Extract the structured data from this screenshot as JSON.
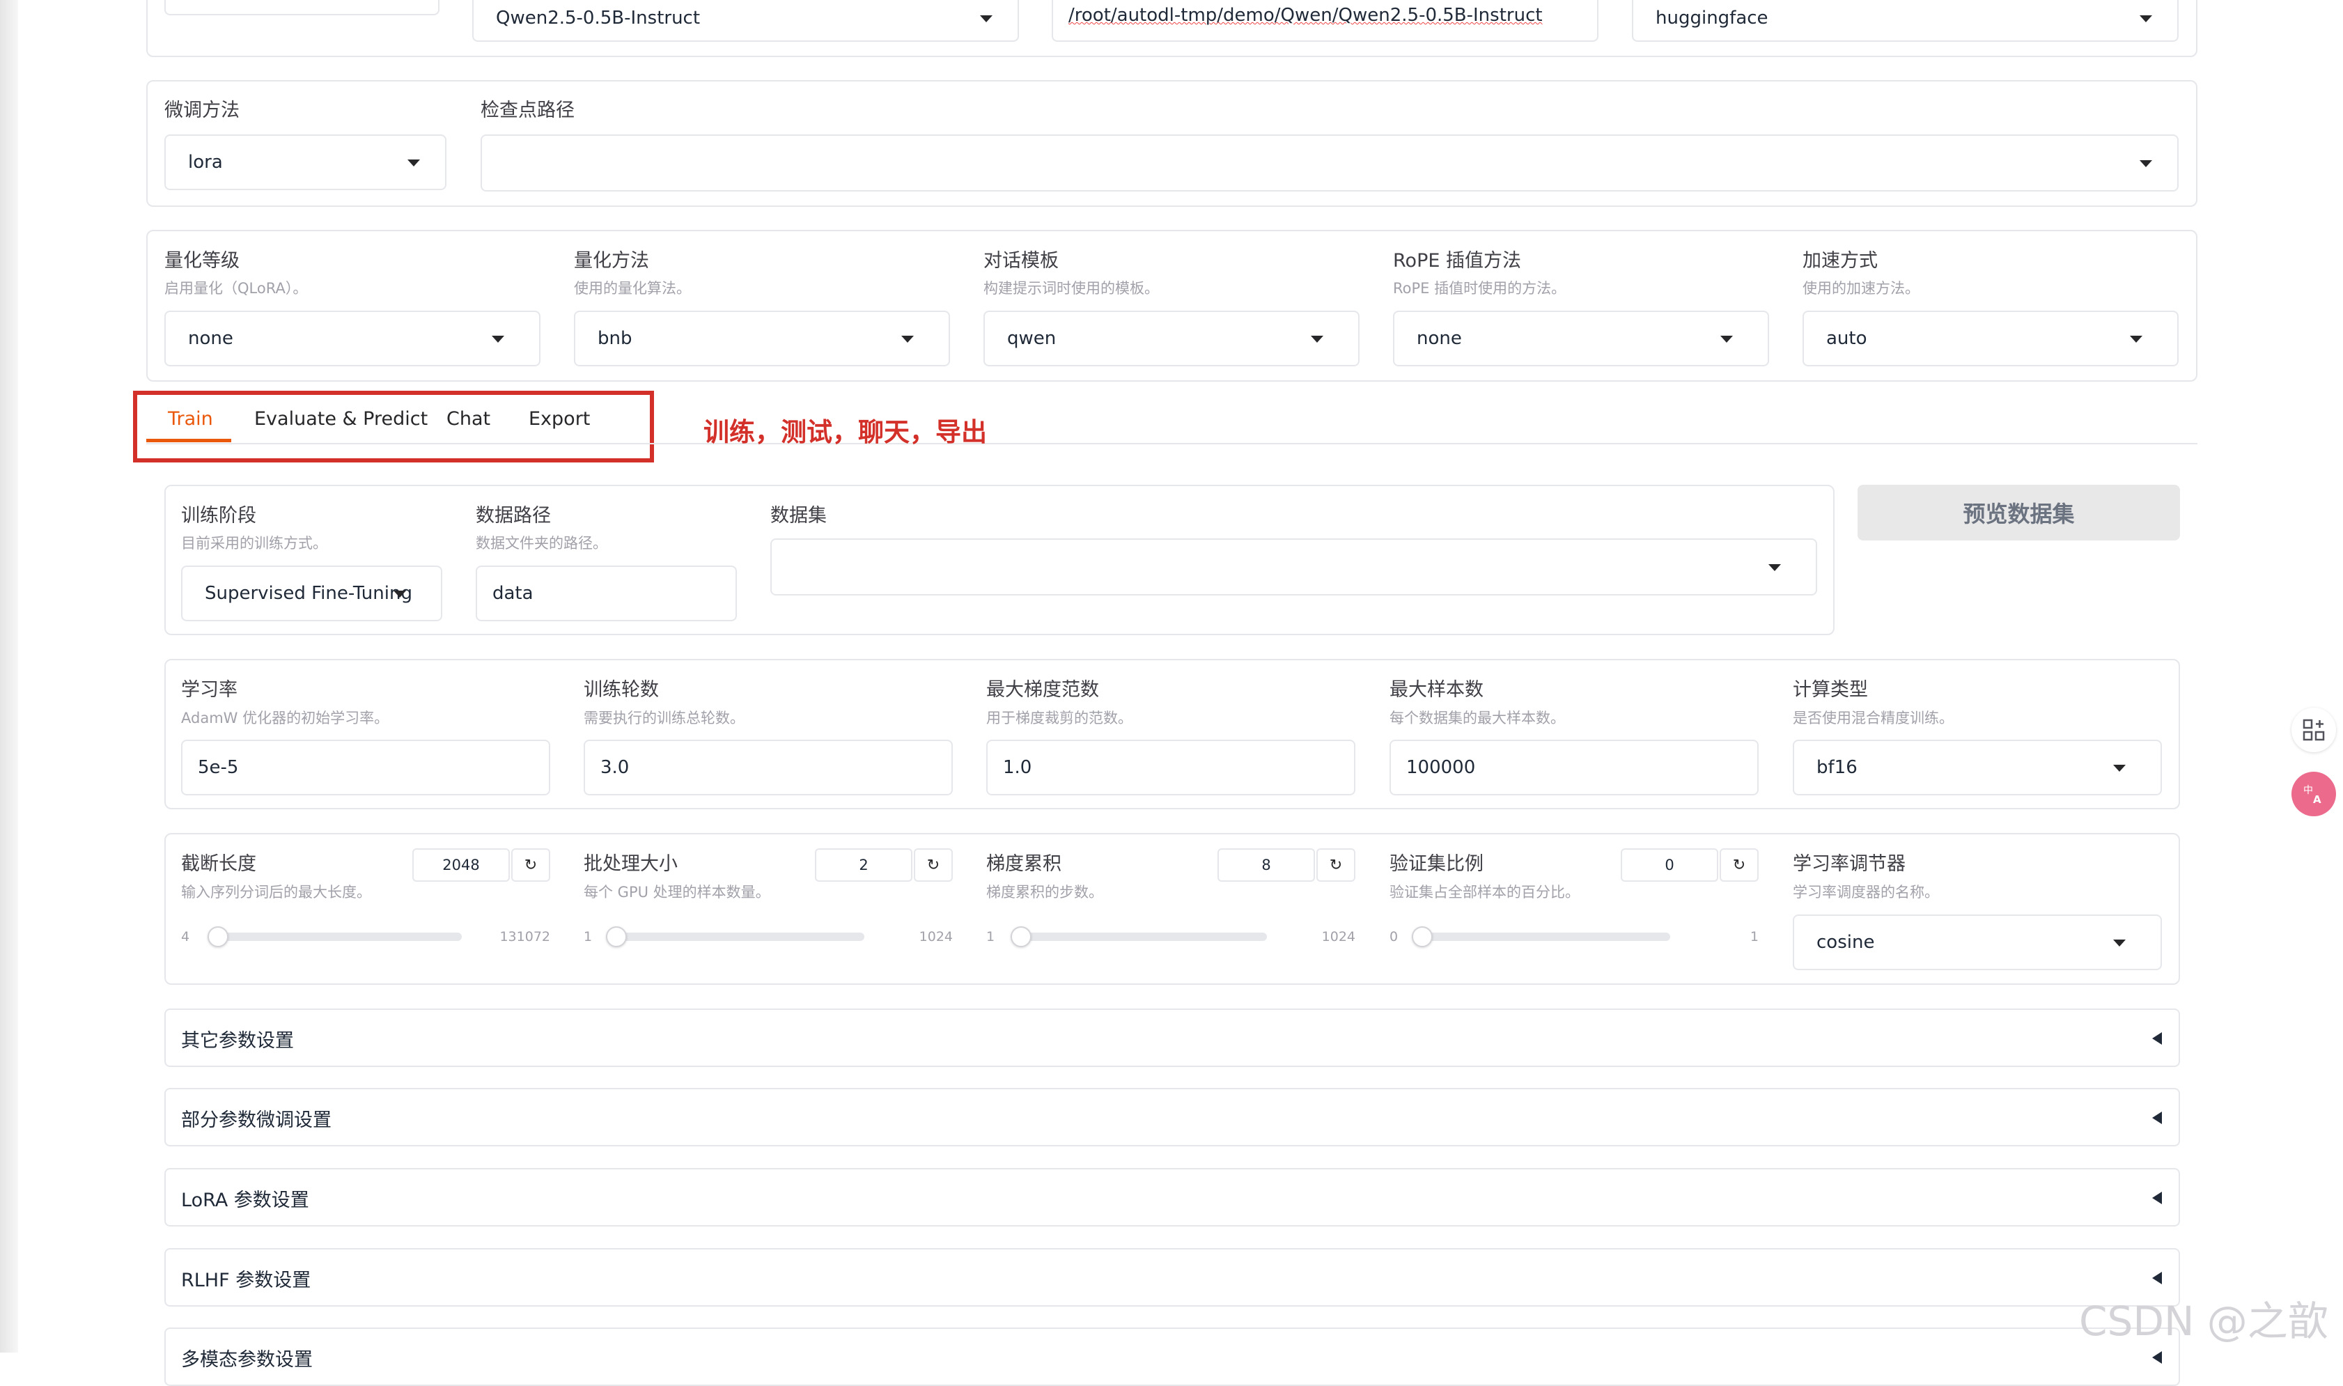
{
  "top_row": {
    "model_name": "Qwen2.5-0.5B-Instruct",
    "model_path": "/root/autodl-tmp/demo/Qwen/Qwen2.5-0.5B-Instruct",
    "hub": "huggingface"
  },
  "finetune": {
    "method_label": "微调方法",
    "method_value": "lora",
    "checkpoint_label": "检查点路径",
    "checkpoint_value": ""
  },
  "quant_row": [
    {
      "label": "量化等级",
      "info": "启用量化（QLoRA）。",
      "value": "none"
    },
    {
      "label": "量化方法",
      "info": "使用的量化算法。",
      "value": "bnb"
    },
    {
      "label": "对话模板",
      "info": "构建提示词时使用的模板。",
      "value": "qwen"
    },
    {
      "label": "RoPE 插值方法",
      "info": "RoPE 插值时使用的方法。",
      "value": "none"
    },
    {
      "label": "加速方式",
      "info": "使用的加速方法。",
      "value": "auto"
    }
  ],
  "tabs": [
    {
      "label": "Train",
      "active": true
    },
    {
      "label": "Evaluate & Predict",
      "active": false
    },
    {
      "label": "Chat",
      "active": false
    },
    {
      "label": "Export",
      "active": false
    }
  ],
  "annotation": {
    "text": "训练，测试，聊天，导出",
    "color": "#d3302a"
  },
  "train_stage": {
    "stage_label": "训练阶段",
    "stage_info": "目前采用的训练方式。",
    "stage_value": "Supervised Fine-Tuning",
    "dir_label": "数据路径",
    "dir_info": "数据文件夹的路径。",
    "dir_value": "data",
    "dataset_label": "数据集",
    "dataset_value": "",
    "preview_button": "预览数据集"
  },
  "hyper_row": [
    {
      "label": "学习率",
      "info": "AdamW 优化器的初始学习率。",
      "value": "5e-5"
    },
    {
      "label": "训练轮数",
      "info": "需要执行的训练总轮数。",
      "value": "3.0"
    },
    {
      "label": "最大梯度范数",
      "info": "用于梯度裁剪的范数。",
      "value": "1.0"
    },
    {
      "label": "最大样本数",
      "info": "每个数据集的最大样本数。",
      "value": "100000"
    },
    {
      "label": "计算类型",
      "info": "是否使用混合精度训练。",
      "value": "bf16"
    }
  ],
  "slider_row": [
    {
      "label": "截断长度",
      "info": "输入序列分词后的最大长度。",
      "value": "2048",
      "min": "4",
      "max": "131072",
      "fraction": 0.016
    },
    {
      "label": "批处理大小",
      "info": "每个 GPU 处理的样本数量。",
      "value": "2",
      "min": "1",
      "max": "1024",
      "fraction": 0.001
    },
    {
      "label": "梯度累积",
      "info": "梯度累积的步数。",
      "value": "8",
      "min": "1",
      "max": "1024",
      "fraction": 0.007
    },
    {
      "label": "验证集比例",
      "info": "验证集占全部样本的百分比。",
      "value": "0",
      "min": "0",
      "max": "1",
      "fraction": 0.0
    }
  ],
  "scheduler": {
    "label": "学习率调节器",
    "info": "学习率调度器的名称。",
    "value": "cosine"
  },
  "accordions": [
    "其它参数设置",
    "部分参数微调设置",
    "LoRA 参数设置",
    "RLHF 参数设置",
    "多模态参数设置"
  ],
  "watermark": "CSDN @之歆",
  "colors": {
    "accent": "#ea580c",
    "annotation": "#d3302a",
    "border": "#e5e7eb"
  }
}
